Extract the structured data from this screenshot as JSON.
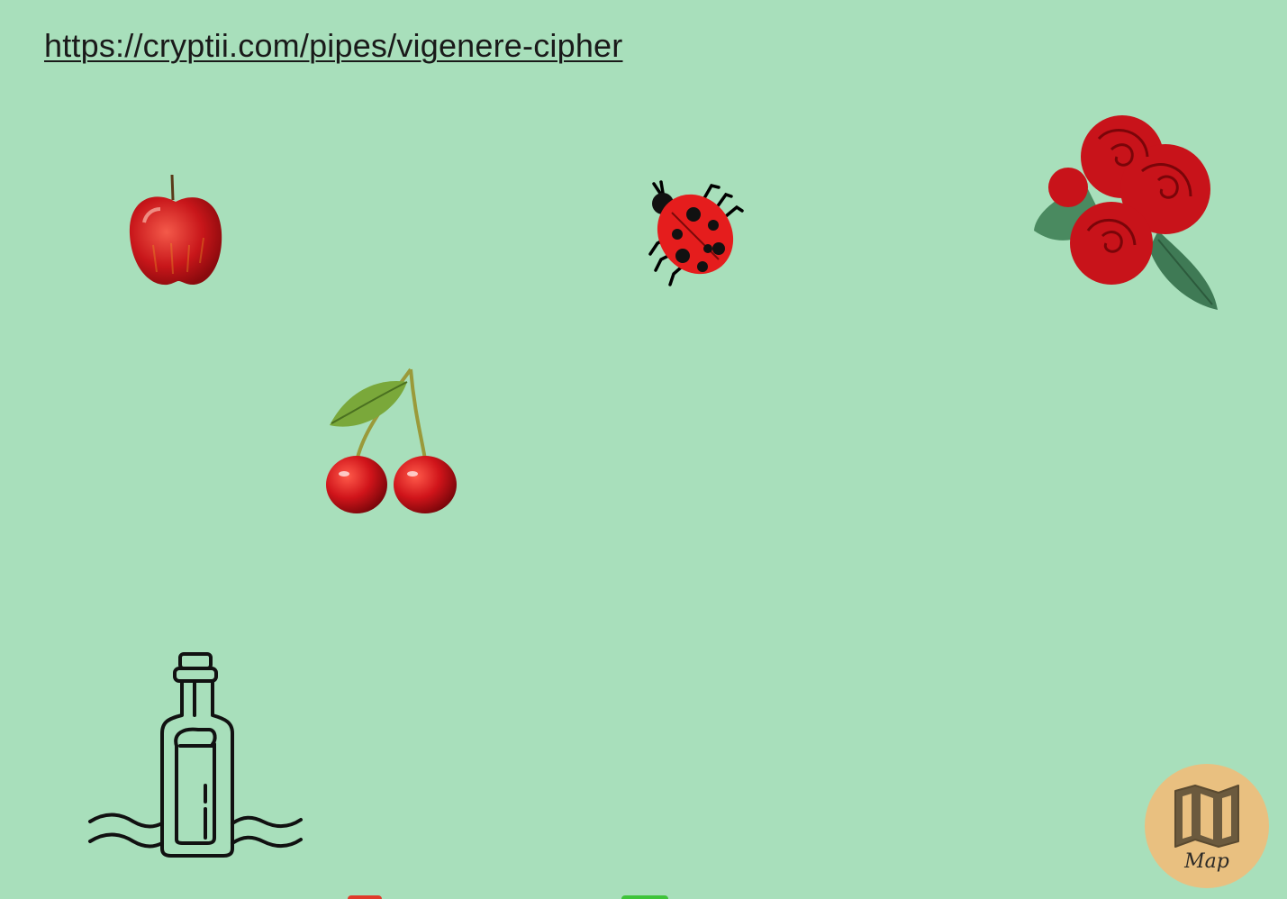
{
  "page": {
    "link_text": "https://cryptii.com/pipes/vigenere-cipher",
    "background_color": "#a8dfbb"
  },
  "scene": {
    "items": [
      {
        "name": "apple",
        "icon": "apple-icon"
      },
      {
        "name": "ladybug",
        "icon": "ladybug-icon"
      },
      {
        "name": "roses",
        "icon": "roses-icon"
      },
      {
        "name": "cherries",
        "icon": "cherries-icon"
      },
      {
        "name": "message-in-a-bottle",
        "icon": "bottle-icon"
      }
    ]
  },
  "map_button": {
    "label": "Map",
    "icon": "map-icon",
    "color": "#e9c080"
  }
}
